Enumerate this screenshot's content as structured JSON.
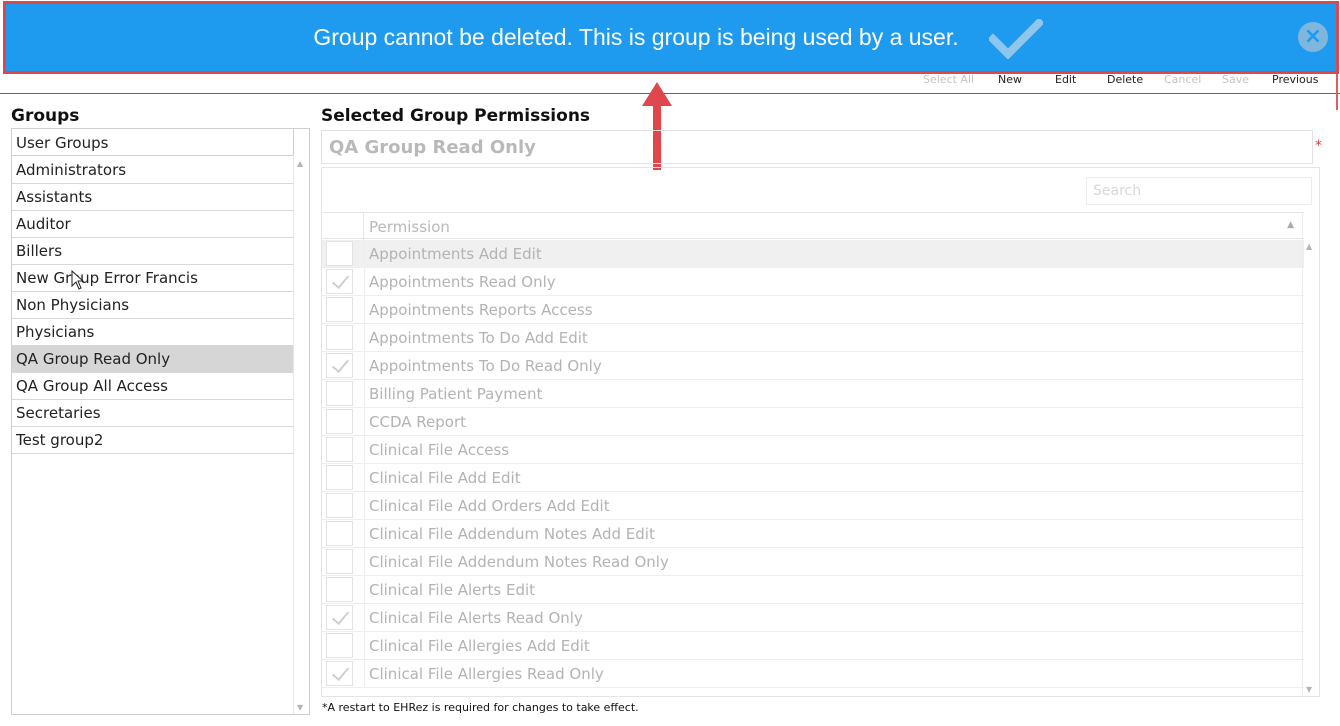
{
  "notification": {
    "message": "Group cannot be deleted. This is group is being used by a user.",
    "icon": "checkmark-icon",
    "close_icon": "close-circle-icon",
    "background": "#1e9bef"
  },
  "toolbar": {
    "select_all": "Select All",
    "new": "New",
    "edit": "Edit",
    "delete": "Delete",
    "cancel": "Cancel",
    "save": "Save",
    "previous": "Previous"
  },
  "groups": {
    "title": "Groups",
    "column_header": "User Groups",
    "items": [
      {
        "label": "Administrators"
      },
      {
        "label": "Assistants"
      },
      {
        "label": "Auditor"
      },
      {
        "label": "Billers"
      },
      {
        "label": "New Group Error Francis"
      },
      {
        "label": "Non Physicians"
      },
      {
        "label": "Physicians"
      },
      {
        "label": "QA Group  Read Only"
      },
      {
        "label": "QA Group All Access"
      },
      {
        "label": "Secretaries"
      },
      {
        "label": "Test group2"
      }
    ],
    "selected_index": 7
  },
  "permissions": {
    "title": "Selected Group Permissions",
    "group_name": "QA Group  Read Only",
    "required_mark": "*",
    "search_placeholder": "Search",
    "column_header": "Permission",
    "rows": [
      {
        "name": "Appointments Add Edit",
        "checked": false
      },
      {
        "name": "Appointments Read Only",
        "checked": true
      },
      {
        "name": "Appointments Reports Access",
        "checked": false
      },
      {
        "name": "Appointments To Do Add Edit",
        "checked": false
      },
      {
        "name": "Appointments To Do Read Only",
        "checked": true
      },
      {
        "name": "Billing Patient Payment",
        "checked": false
      },
      {
        "name": "CCDA Report",
        "checked": false
      },
      {
        "name": "Clinical File Access",
        "checked": false
      },
      {
        "name": "Clinical File Add Edit",
        "checked": false
      },
      {
        "name": "Clinical File Add Orders Add Edit",
        "checked": false
      },
      {
        "name": "Clinical File Addendum Notes Add Edit",
        "checked": false
      },
      {
        "name": "Clinical File Addendum Notes Read Only",
        "checked": false
      },
      {
        "name": "Clinical File Alerts Edit",
        "checked": false
      },
      {
        "name": "Clinical File Alerts Read Only",
        "checked": true
      },
      {
        "name": "Clinical File Allergies Add Edit",
        "checked": false
      },
      {
        "name": "Clinical File Allergies Read Only",
        "checked": true
      }
    ],
    "footnote": "*A restart to EHRez is required for changes to take effect."
  },
  "colors": {
    "accent": "#1e9bef",
    "annotation_red": "#e0474c",
    "selected_row": "#d6d6d6"
  }
}
